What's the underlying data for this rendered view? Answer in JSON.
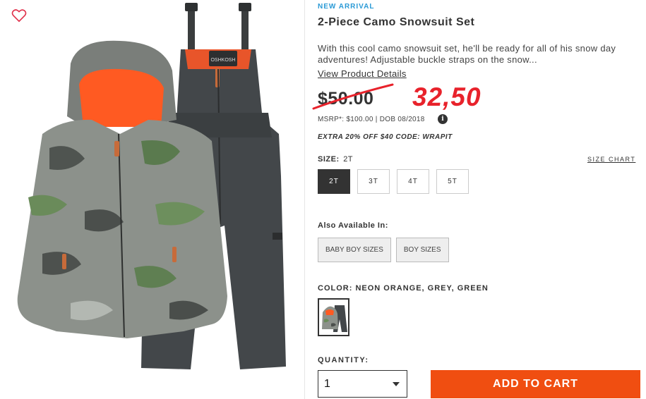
{
  "product": {
    "badge": "NEW ARRIVAL",
    "title": "2-Piece Camo Snowsuit Set",
    "description": "With this cool camo snowsuit set, he'll be ready for all of his snow day adventures! Adjustable buckle straps on the snow...",
    "details_link": "View Product Details",
    "old_price": "$50.00",
    "new_price": "32,50",
    "msrp": "MSRP*: $100.00 | DOB 08/2018",
    "info_icon": "i",
    "promo": "EXTRA 20% OFF $40 CODE: WRAPIT"
  },
  "size": {
    "label": "SIZE:",
    "selected": "2T",
    "chart_link": "SIZE CHART",
    "options": [
      "2T",
      "3T",
      "4T",
      "5T"
    ]
  },
  "also_available": {
    "label": "Also Available In:",
    "options": [
      "BABY BOY SIZES",
      "BOY SIZES"
    ]
  },
  "color": {
    "label": "COLOR: NEON ORANGE, GREY, GREEN"
  },
  "quantity": {
    "label": "QUANTITY:",
    "value": "1"
  },
  "cart": {
    "button_label": "ADD TO CART"
  },
  "icons": {
    "favorite": "heart-icon",
    "dropdown": "chevron-down-icon",
    "info": "info-icon"
  },
  "colors": {
    "accent_blue": "#2a9ad6",
    "sale_red": "#e8222b",
    "cta_orange": "#f04e11",
    "selected_dark": "#333333"
  }
}
